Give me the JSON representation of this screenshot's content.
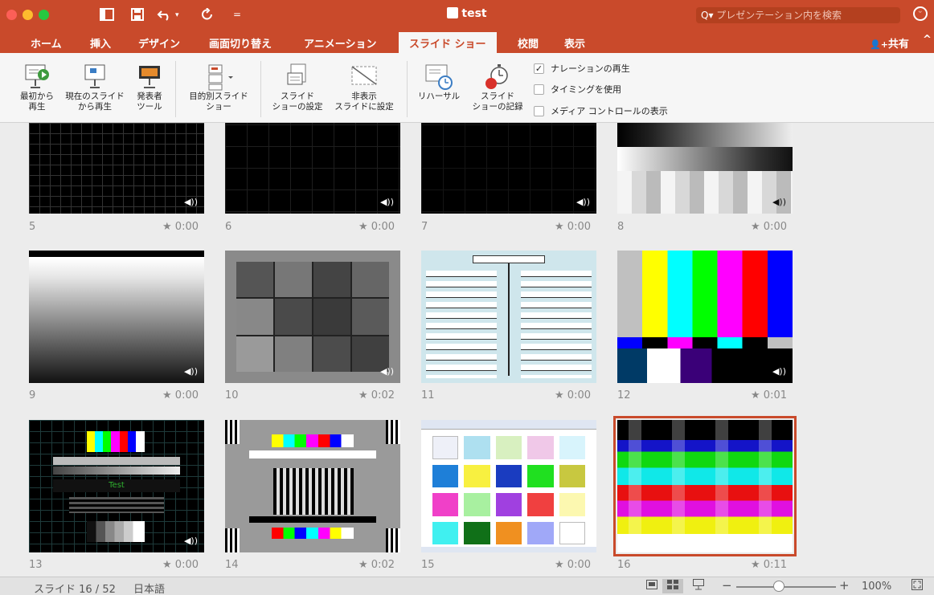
{
  "window": {
    "title": "test",
    "search_placeholder": "プレゼンテーション内を検索",
    "colors": {
      "accent": "#c94a2b",
      "ribbon": "#f6f6f6",
      "selection": "#c94a2b"
    }
  },
  "titlebar_icons": [
    "sidebar-toggle-icon",
    "save-icon",
    "undo-icon",
    "redo-icon",
    "customize-toolbar-icon"
  ],
  "tabs": [
    {
      "label": "ホーム"
    },
    {
      "label": "挿入"
    },
    {
      "label": "デザイン"
    },
    {
      "label": "画面切り替え"
    },
    {
      "label": "アニメーション"
    },
    {
      "label": "スライド ショー",
      "active": true
    },
    {
      "label": "校閲"
    },
    {
      "label": "表示"
    }
  ],
  "share_label": "共有",
  "ribbon": {
    "buttons": [
      {
        "label": "最初から\n再生",
        "icon": "play-from-start-icon"
      },
      {
        "label": "現在のスライド\nから再生",
        "icon": "play-from-current-icon"
      },
      {
        "label": "発表者\nツール",
        "icon": "presenter-view-icon"
      },
      {
        "label": "目的別スライド\nショー",
        "icon": "custom-show-icon"
      },
      {
        "label": "スライド\nショーの設定",
        "icon": "setup-show-icon"
      },
      {
        "label": "非表示\nスライドに設定",
        "icon": "hide-slide-icon"
      },
      {
        "label": "リハーサル",
        "icon": "rehearse-timings-icon"
      },
      {
        "label": "スライド\nショーの記録",
        "icon": "record-show-icon"
      }
    ],
    "checkboxes": [
      {
        "label": "ナレーションの再生",
        "checked": true
      },
      {
        "label": "タイミングを使用",
        "checked": false
      },
      {
        "label": "メディア コントロールの表示",
        "checked": false
      }
    ]
  },
  "slides": [
    {
      "num": "5",
      "time": "0:00",
      "has_audio": true
    },
    {
      "num": "6",
      "time": "0:00",
      "has_audio": true
    },
    {
      "num": "7",
      "time": "0:00",
      "has_audio": true
    },
    {
      "num": "8",
      "time": "0:00",
      "has_audio": true
    },
    {
      "num": "9",
      "time": "0:00",
      "has_audio": true
    },
    {
      "num": "10",
      "time": "0:02",
      "has_audio": true
    },
    {
      "num": "11",
      "time": "0:00",
      "has_audio": false
    },
    {
      "num": "12",
      "time": "0:01",
      "has_audio": true
    },
    {
      "num": "13",
      "time": "0:00",
      "has_audio": true,
      "text": "Test"
    },
    {
      "num": "14",
      "time": "0:02",
      "has_audio": false
    },
    {
      "num": "15",
      "time": "0:00",
      "has_audio": false
    },
    {
      "num": "16",
      "time": "0:11",
      "has_audio": false,
      "selected": true
    }
  ],
  "status": {
    "slide_label": "スライド 16 / 52",
    "language": "日本語",
    "zoom": "100%",
    "zoom_minus": "−",
    "zoom_plus": "+",
    "view_icons": [
      "normal-view-icon",
      "slide-sorter-view-icon",
      "reading-view-icon"
    ]
  },
  "glyphs": {
    "star": "★",
    "speaker": "◀))",
    "check": "✓",
    "search_prefix": "Q▾",
    "share_icon": "👤+"
  }
}
